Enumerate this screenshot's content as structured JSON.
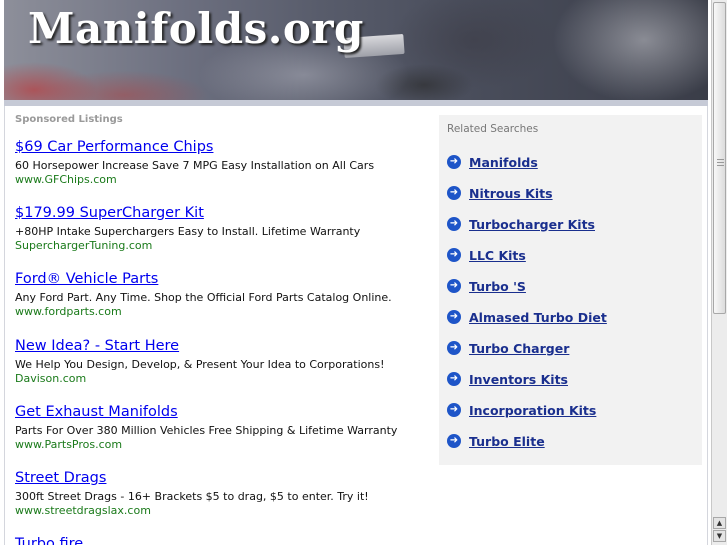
{
  "header": {
    "site_title": "Manifolds.org"
  },
  "sponsored": {
    "heading": "Sponsored Listings",
    "listings": [
      {
        "title": "$69 Car Performance Chips",
        "description": "60 Horsepower Increase Save 7 MPG Easy Installation on All Cars",
        "url": "www.GFChips.com"
      },
      {
        "title": "$179.99 SuperCharger Kit",
        "description": "+80HP Intake Superchargers Easy to Install. Lifetime Warranty",
        "url": "SuperchargerTuning.com"
      },
      {
        "title": "Ford® Vehicle Parts",
        "description": "Any Ford Part. Any Time. Shop the Official Ford Parts Catalog Online.",
        "url": "www.fordparts.com"
      },
      {
        "title": "New Idea? - Start Here",
        "description": "We Help You Design, Develop, & Present Your Idea to Corporations!",
        "url": "Davison.com"
      },
      {
        "title": "Get Exhaust Manifolds",
        "description": "Parts For Over 380 Million Vehicles Free Shipping & Lifetime Warranty",
        "url": "www.PartsPros.com"
      },
      {
        "title": "Street Drags",
        "description": "300ft Street Drags - 16+ Brackets $5 to drag, $5 to enter. Try it!",
        "url": "www.streetdragslax.com"
      },
      {
        "title": "Turbo fire",
        "description": "",
        "url": ""
      }
    ]
  },
  "related": {
    "heading": "Related Searches",
    "items": [
      "Manifolds",
      "Nitrous Kits",
      "Turbocharger Kits",
      "LLC Kits",
      "Turbo 'S",
      "Almased Turbo Diet",
      "Turbo Charger",
      "Inventors Kits",
      "Incorporation Kits",
      "Turbo Elite"
    ],
    "icon": "arrow-circle-icon"
  },
  "scrollbar": {
    "up_arrow": "▲",
    "down_arrow": "▼"
  }
}
